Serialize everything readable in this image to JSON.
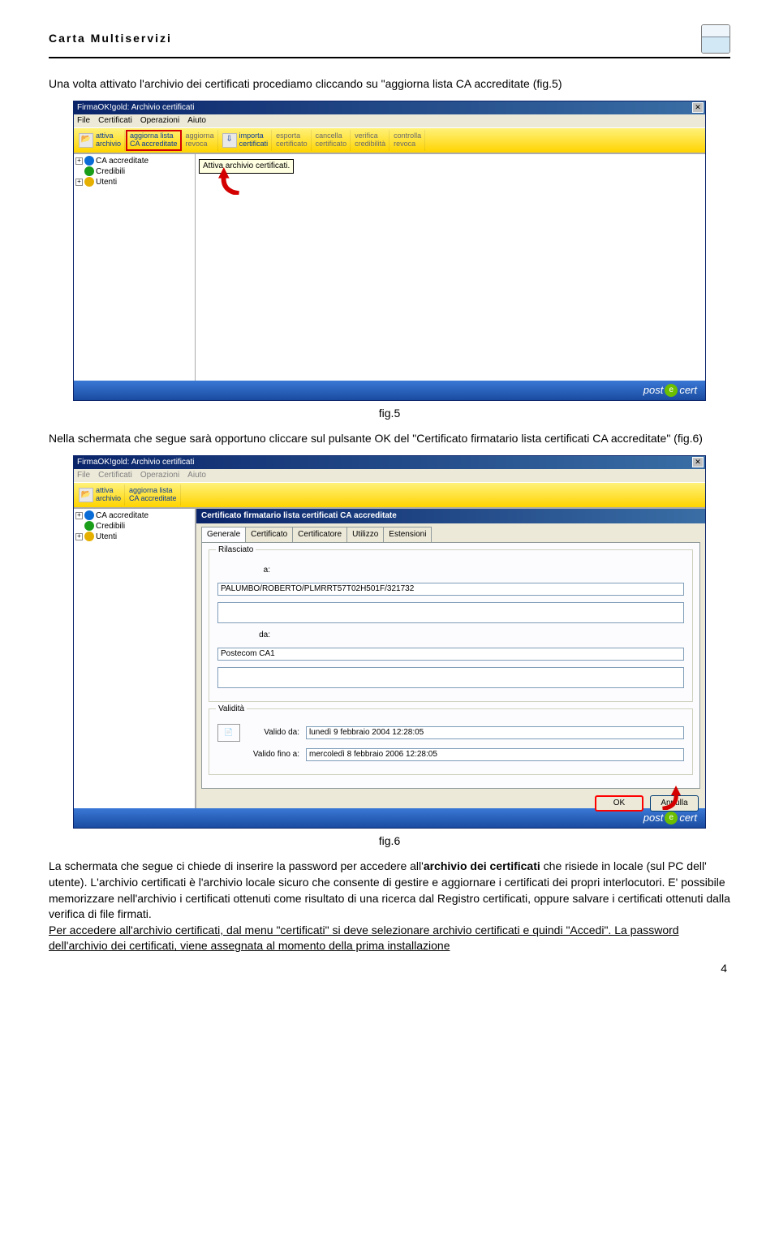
{
  "header": {
    "title": "Carta Multiservizi"
  },
  "para1_a": "Una volta attivato l'archivio dei certificati procediamo cliccando su \"aggiorna lista CA accreditate (fig.5)",
  "fig5": {
    "window_title": "FirmaOK!gold: Archivio certificati",
    "menus": [
      "File",
      "Certificati",
      "Operazioni",
      "Aiuto"
    ],
    "toolbar": [
      {
        "top": "attiva",
        "bottom": "archivio",
        "active": true
      },
      {
        "top": "aggiorna lista",
        "bottom": "CA accreditate",
        "active": true,
        "highlight": true
      },
      {
        "top": "aggiorna",
        "bottom": "revoca",
        "active": false
      },
      {
        "top": "importa",
        "bottom": "certificati",
        "active": true
      },
      {
        "top": "esporta",
        "bottom": "certificato",
        "active": false
      },
      {
        "top": "cancella",
        "bottom": "certificato",
        "active": false
      },
      {
        "top": "verifica",
        "bottom": "credibilità",
        "active": false
      },
      {
        "top": "controlla",
        "bottom": "revoca",
        "active": false
      }
    ],
    "tooltip": "Attiva archivio certificati.",
    "tree": [
      {
        "plus": true,
        "color": "blue",
        "label": "CA accreditate"
      },
      {
        "plus": false,
        "color": "green",
        "label": "Credibili"
      },
      {
        "plus": true,
        "color": "yellow",
        "label": "Utenti"
      }
    ],
    "footer": "postecert",
    "caption": "fig.5"
  },
  "para2": "Nella schermata che segue sarà opportuno cliccare sul pulsante OK del \"Certificato firmatario lista certificati CA accreditate\" (fig.6)",
  "fig6": {
    "window_title": "FirmaOK!gold: Archivio certificati",
    "menus": [
      "File",
      "Certificati",
      "Operazioni",
      "Aiuto"
    ],
    "toolbar": [
      {
        "top": "attiva",
        "bottom": "archivio",
        "active": true
      },
      {
        "top": "aggiorna lista",
        "bottom": "CA accreditate",
        "active": true
      }
    ],
    "tree": [
      {
        "plus": true,
        "color": "blue",
        "label": "CA accreditate"
      },
      {
        "plus": false,
        "color": "green",
        "label": "Credibili"
      },
      {
        "plus": true,
        "color": "yellow",
        "label": "Utenti"
      }
    ],
    "dialog": {
      "title": "Certificato firmatario lista certificati CA accreditate",
      "tabs": [
        "Generale",
        "Certificato",
        "Certificatore",
        "Utilizzo",
        "Estensioni"
      ],
      "active_tab": 0,
      "groups": {
        "rilasciato": {
          "legend": "Rilasciato",
          "a_label": "a:",
          "a_value": "PALUMBO/ROBERTO/PLMRRT57T02H501F/321732",
          "da_label": "da:",
          "da_value": "Postecom CA1"
        },
        "validita": {
          "legend": "Validità",
          "da_label": "Valido da:",
          "da_value": "lunedì 9 febbraio 2004 12:28:05",
          "fino_label": "Valido fino a:",
          "fino_value": "mercoledì 8 febbraio 2006 12:28:05"
        }
      },
      "ok": "OK",
      "cancel": "Annulla"
    },
    "footer": "postecert",
    "caption": "fig.6"
  },
  "para3": {
    "p1_a": "La schermata che segue ci chiede di inserire la password per accedere all'",
    "p1_b": "archivio dei certificati",
    "p1_c": " che risiede in locale (sul PC dell' utente). L'archivio certificati è l'archivio locale sicuro che consente di gestire e aggiornare i certificati dei propri interlocutori. E' possibile memorizzare nell'archivio i certificati ottenuti come risultato di una ricerca dal Registro certificati, oppure salvare i certificati ottenuti dalla verifica di file firmati.",
    "p2": "Per accedere all'archivio certificati, dal menu \"certificati\" si deve selezionare archivio certificati e quindi \"Accedi\". La password dell'archivio dei certificati, viene assegnata al momento della prima installazione"
  },
  "page_number": "4"
}
